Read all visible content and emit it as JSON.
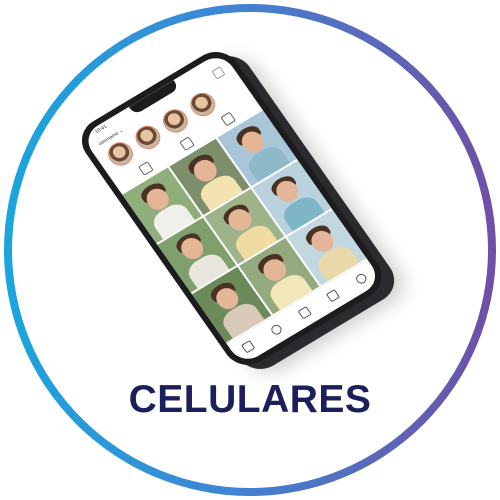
{
  "phone": {
    "status_time": "10:41",
    "username": "username ⌄",
    "photo_colors": [
      {
        "bg": "#8fae7b",
        "shirt": "#f0f0ea"
      },
      {
        "bg": "#7d8f6a",
        "shirt": "#f2e3b0"
      },
      {
        "bg": "#a9c6d8",
        "shirt": "#8fb9c9"
      },
      {
        "bg": "#7fa06d",
        "shirt": "#e9e6de"
      },
      {
        "bg": "#9fb38a",
        "shirt": "#f0dca0"
      },
      {
        "bg": "#b9d2de",
        "shirt": "#7fb6c7"
      },
      {
        "bg": "#6c8a59",
        "shirt": "#d8c9b8"
      },
      {
        "bg": "#94a97e",
        "shirt": "#f2e7b8"
      },
      {
        "bg": "#c3d7e0",
        "shirt": "#e9d9a8"
      }
    ]
  },
  "brand": {
    "ring_start": "#1aa6dc",
    "ring_end": "#6f4fa6",
    "text_color": "#1c1f5b"
  },
  "title": "CELULARES"
}
